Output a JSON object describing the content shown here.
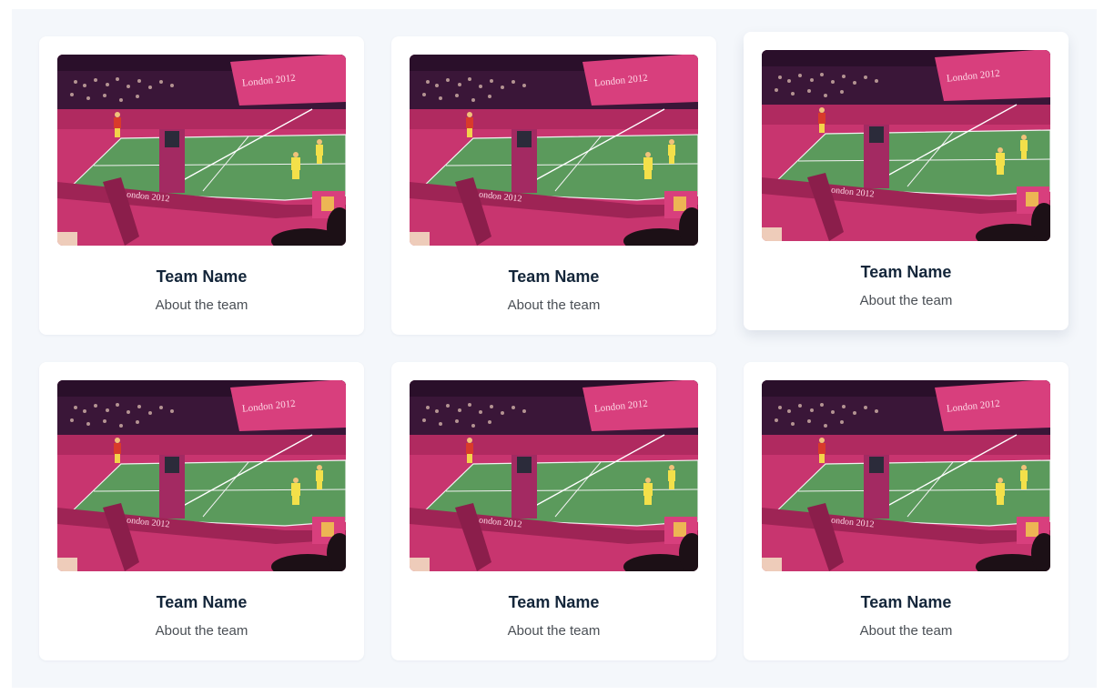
{
  "cards": [
    {
      "title": "Team Name",
      "subtitle": "About the team",
      "image": "badminton-court-photo"
    },
    {
      "title": "Team Name",
      "subtitle": "About the team",
      "image": "badminton-court-photo"
    },
    {
      "title": "Team Name",
      "subtitle": "About the team",
      "image": "badminton-court-photo"
    },
    {
      "title": "Team Name",
      "subtitle": "About the team",
      "image": "badminton-court-photo"
    },
    {
      "title": "Team Name",
      "subtitle": "About the team",
      "image": "badminton-court-photo"
    },
    {
      "title": "Team Name",
      "subtitle": "About the team",
      "image": "badminton-court-photo"
    }
  ],
  "colors": {
    "background": "#f4f7fb",
    "card": "#ffffff",
    "title": "#14263a",
    "subtitle": "#4a4f55"
  }
}
